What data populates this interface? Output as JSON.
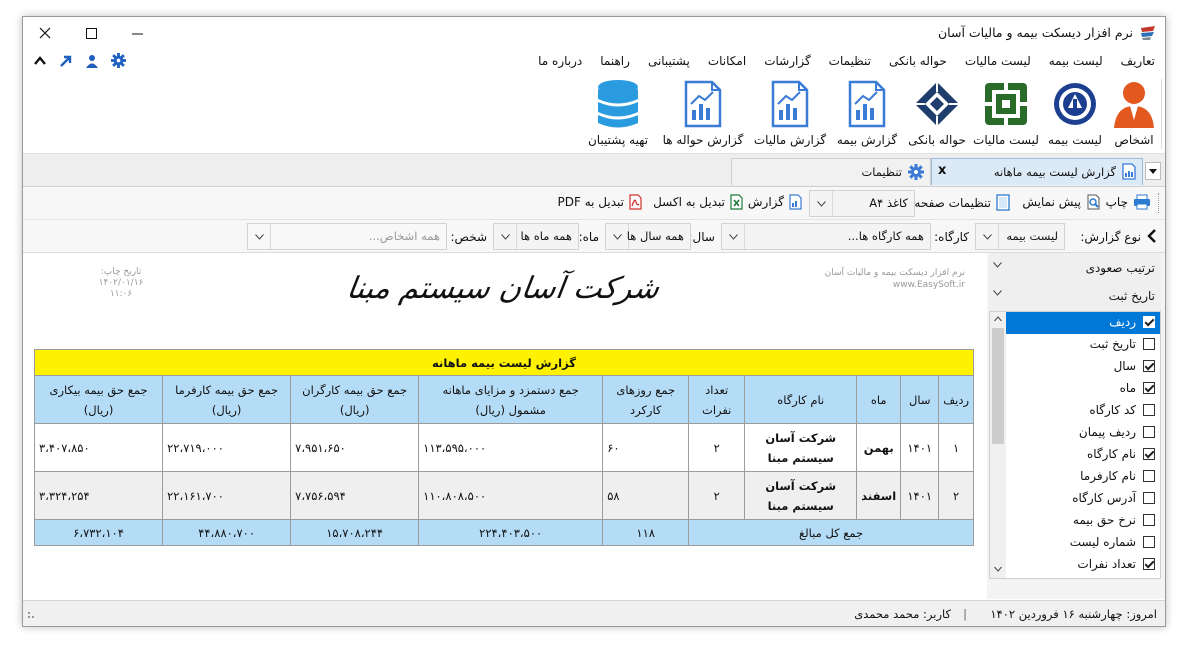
{
  "window": {
    "title": "نرم افزار دیسکت بیمه و مالیات آسان"
  },
  "menu": [
    "تعاریف",
    "لیست بیمه",
    "لیست مالیات",
    "حواله بانکی",
    "تنظیمات",
    "گزارشات",
    "امکانات",
    "پشتیبانی",
    "راهنما",
    "درباره ما"
  ],
  "ribbon": [
    "اشخاص",
    "لیست بیمه",
    "لیست مالیات",
    "حواله بانکی",
    "گزارش بیمه",
    "گزارش مالیات",
    "گزارش حواله ها",
    "تهیه پشتیبان"
  ],
  "tabs": {
    "active": "گزارش لیست بیمه ماهانه",
    "close": "x",
    "other": "تنظیمات"
  },
  "toolbar": {
    "print": "چاپ",
    "preview": "پیش نمایش",
    "page_setup": "تنظیمات صفحه",
    "paper": "کاغذ A۴",
    "report": "گزارش",
    "excel": "تبدیل به اکسل",
    "pdf": "تبدیل به PDF"
  },
  "filters": {
    "type_label": "نوع گزارش:",
    "type_value": "لیست بیمه",
    "workshop_label": "کارگاه:",
    "workshop_value": "همه کارگاه ها...",
    "year_label": "سال:",
    "year_value": "همه سال ها",
    "month_label": "ماه:",
    "month_value": "همه ماه ها",
    "person_label": "شخص:",
    "person_placeholder": "همه اشخاص..."
  },
  "report": {
    "company": "شرکت آسان سیستم مبنا",
    "left_header": {
      "line1": "تاریخ چاپ:",
      "line2": "۱۴۰۲/۰۱/۱۶",
      "line3": "۱۱:۰۶"
    },
    "right_header": {
      "line1": "نرم افزار دیسکت بیمه و مالیات آسان",
      "line2": "www.EasySoft.ir"
    },
    "table_title": "گزارش لیست بیمه ماهانه",
    "columns": [
      {
        "l1": "ردیف",
        "l2": ""
      },
      {
        "l1": "سال",
        "l2": ""
      },
      {
        "l1": "ماه",
        "l2": ""
      },
      {
        "l1": "نام کارگاه",
        "l2": ""
      },
      {
        "l1": "تعداد",
        "l2": "نفرات"
      },
      {
        "l1": "جمع روزهای",
        "l2": "کارکرد"
      },
      {
        "l1": "جمع دستمزد و مزایای ماهانه",
        "l2": "مشمول (ریال)"
      },
      {
        "l1": "جمع حق بیمه کارگران",
        "l2": "(ریال)"
      },
      {
        "l1": "جمع حق بیمه کارفرما",
        "l2": "(ریال)"
      },
      {
        "l1": "جمع حق بیمه بیکاری",
        "l2": "(ریال)"
      }
    ],
    "rows": [
      {
        "c0": "۱",
        "c1": "۱۴۰۱",
        "c2": "بهمن",
        "c3a": "شرکت آسان",
        "c3b": "سیستم مبنا",
        "c4": "۲",
        "c5": "۶۰",
        "c6": "۱۱۳،۵۹۵،۰۰۰",
        "c7": "۷،۹۵۱،۶۵۰",
        "c8": "۲۲،۷۱۹،۰۰۰",
        "c9": "۳،۴۰۷،۸۵۰"
      },
      {
        "c0": "۲",
        "c1": "۱۴۰۱",
        "c2": "اسفند",
        "c3a": "شرکت آسان",
        "c3b": "سیستم مبنا",
        "c4": "۲",
        "c5": "۵۸",
        "c6": "۱۱۰،۸۰۸،۵۰۰",
        "c7": "۷،۷۵۶،۵۹۴",
        "c8": "۲۲،۱۶۱،۷۰۰",
        "c9": "۳،۳۲۴،۲۵۴"
      }
    ],
    "totals": {
      "label": "جمع کل مبالغ",
      "days": "۱۱۸",
      "wage": "۲۲۴،۴۰۳،۵۰۰",
      "worker": "۱۵،۷۰۸،۲۴۴",
      "employer": "۴۴،۸۸۰،۷۰۰",
      "unemp": "۶،۷۳۲،۱۰۴"
    }
  },
  "sidepanel": {
    "sort": "ترتیب صعودی",
    "sort_field": "تاریخ ثبت",
    "columns": [
      {
        "label": "ردیف",
        "checked": true,
        "selected": true
      },
      {
        "label": "تاریخ ثبت",
        "checked": false
      },
      {
        "label": "سال",
        "checked": true
      },
      {
        "label": "ماه",
        "checked": true
      },
      {
        "label": "کد کارگاه",
        "checked": false
      },
      {
        "label": "ردیف پیمان",
        "checked": false
      },
      {
        "label": "نام کارگاه",
        "checked": true
      },
      {
        "label": "نام کارفرما",
        "checked": false
      },
      {
        "label": "آدرس کارگاه",
        "checked": false
      },
      {
        "label": "نرخ حق بیمه",
        "checked": false
      },
      {
        "label": "شماره لیست",
        "checked": false
      },
      {
        "label": "تعداد نفرات",
        "checked": true
      }
    ]
  },
  "status": {
    "today": "امروز: چهارشنبه ۱۶ فروردین ۱۴۰۲",
    "sep": "|",
    "user": "کاربر: محمد محمدی"
  }
}
